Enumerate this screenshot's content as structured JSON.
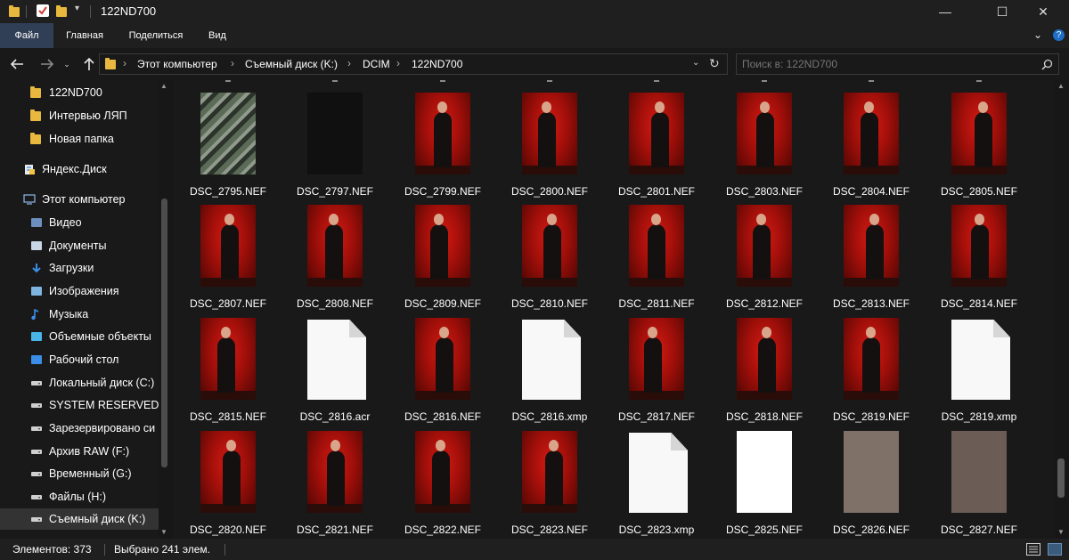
{
  "window": {
    "title": "122ND700",
    "minimize_glyph": "—",
    "maximize_glyph": "☐",
    "close_glyph": "✕"
  },
  "ribbon": {
    "tabs": [
      "Файл",
      "Главная",
      "Поделиться",
      "Вид"
    ]
  },
  "address": {
    "crumbs": [
      "Этот компьютер",
      "Съемный диск (K:)",
      "DCIM",
      "122ND700"
    ]
  },
  "search": {
    "placeholder": "Поиск в: 122ND700"
  },
  "nav": {
    "items": [
      {
        "label": "122ND700",
        "icon": "folder-icon"
      },
      {
        "label": "Интервью ЛЯП",
        "icon": "folder-icon"
      },
      {
        "label": "Новая папка",
        "icon": "folder-icon"
      },
      {
        "label": "Яндекс.Диск",
        "icon": "yandex-disk-icon"
      },
      {
        "label": "Этот компьютер",
        "icon": "computer-icon"
      },
      {
        "label": "Видео",
        "icon": "video-icon"
      },
      {
        "label": "Документы",
        "icon": "documents-icon"
      },
      {
        "label": "Загрузки",
        "icon": "downloads-icon"
      },
      {
        "label": "Изображения",
        "icon": "pictures-icon"
      },
      {
        "label": "Музыка",
        "icon": "music-icon"
      },
      {
        "label": "Объемные объекты",
        "icon": "3d-objects-icon"
      },
      {
        "label": "Рабочий стол",
        "icon": "desktop-icon"
      },
      {
        "label": "Локальный диск (C:)",
        "icon": "drive-icon"
      },
      {
        "label": "SYSTEM RESERVED (D",
        "icon": "drive-icon"
      },
      {
        "label": "Зарезервировано си",
        "icon": "drive-icon"
      },
      {
        "label": "Архив RAW (F:)",
        "icon": "drive-icon"
      },
      {
        "label": "Временный (G:)",
        "icon": "drive-icon"
      },
      {
        "label": "Файлы (H:)",
        "icon": "drive-icon"
      },
      {
        "label": "Съемный диск (K:)",
        "icon": "drive-icon",
        "selected": true
      }
    ]
  },
  "files": [
    {
      "name": "DSC_2795.NEF",
      "thumb": "plant"
    },
    {
      "name": "DSC_2797.NEF",
      "thumb": "dark"
    },
    {
      "name": "DSC_2799.NEF",
      "thumb": "red"
    },
    {
      "name": "DSC_2800.NEF",
      "thumb": "red"
    },
    {
      "name": "DSC_2801.NEF",
      "thumb": "red"
    },
    {
      "name": "DSC_2803.NEF",
      "thumb": "red"
    },
    {
      "name": "DSC_2804.NEF",
      "thumb": "red"
    },
    {
      "name": "DSC_2805.NEF",
      "thumb": "red"
    },
    {
      "name": "DSC_2807.NEF",
      "thumb": "red"
    },
    {
      "name": "DSC_2808.NEF",
      "thumb": "red"
    },
    {
      "name": "DSC_2809.NEF",
      "thumb": "red"
    },
    {
      "name": "DSC_2810.NEF",
      "thumb": "red"
    },
    {
      "name": "DSC_2811.NEF",
      "thumb": "red"
    },
    {
      "name": "DSC_2812.NEF",
      "thumb": "red"
    },
    {
      "name": "DSC_2813.NEF",
      "thumb": "red"
    },
    {
      "name": "DSC_2814.NEF",
      "thumb": "red"
    },
    {
      "name": "DSC_2815.NEF",
      "thumb": "red"
    },
    {
      "name": "DSC_2816.acr",
      "thumb": "doc"
    },
    {
      "name": "DSC_2816.NEF",
      "thumb": "red"
    },
    {
      "name": "DSC_2816.xmp",
      "thumb": "doc"
    },
    {
      "name": "DSC_2817.NEF",
      "thumb": "red"
    },
    {
      "name": "DSC_2818.NEF",
      "thumb": "red"
    },
    {
      "name": "DSC_2819.NEF",
      "thumb": "red"
    },
    {
      "name": "DSC_2819.xmp",
      "thumb": "doc"
    },
    {
      "name": "DSC_2820.NEF",
      "thumb": "red"
    },
    {
      "name": "DSC_2821.NEF",
      "thumb": "red"
    },
    {
      "name": "DSC_2822.NEF",
      "thumb": "red"
    },
    {
      "name": "DSC_2823.NEF",
      "thumb": "red"
    },
    {
      "name": "DSC_2823.xmp",
      "thumb": "doc"
    },
    {
      "name": "DSC_2825.NEF",
      "thumb": "whitepage"
    },
    {
      "name": "DSC_2826.NEF",
      "thumb": "grey1"
    },
    {
      "name": "DSC_2827.NEF",
      "thumb": "grey2"
    }
  ],
  "status": {
    "items_count": "Элементов: 373",
    "selected": "Выбрано 241 элем."
  },
  "colors": {
    "background": "#191919",
    "file_tab_accent": "#303f55",
    "folder": "#e8b93e",
    "thumb_red": "#c8140e"
  }
}
